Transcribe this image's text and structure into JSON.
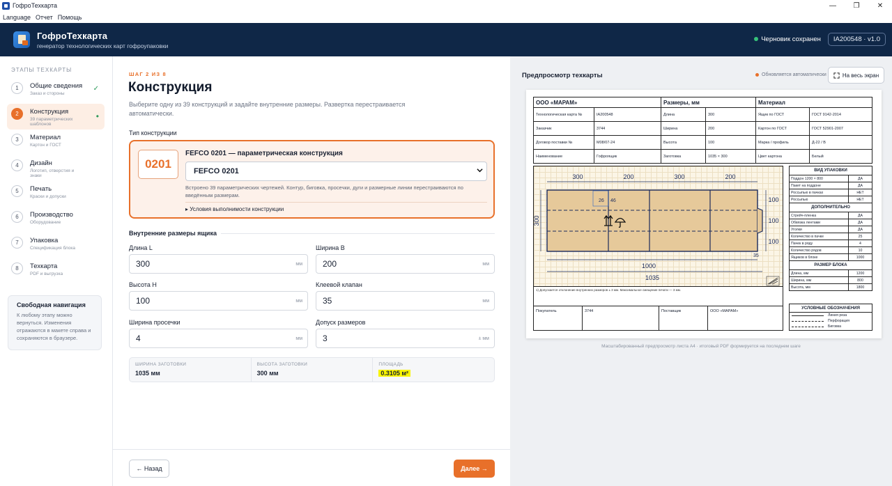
{
  "window": {
    "title": "ГофроТехкарта",
    "controls": [
      "—",
      "❐",
      "✕"
    ]
  },
  "menu": [
    "Language",
    "Отчет",
    "Помощь"
  ],
  "header": {
    "title": "ГофроТехкарта",
    "subtitle": "генератор технологических карт гофроупаковки",
    "status": "Черновик сохранен",
    "version": "IA200548 · v1.0",
    "status_color": "#36c27a"
  },
  "sidebar": {
    "title": "ЭТАПЫ ТЕХКАРТЫ",
    "steps": [
      {
        "num": "1",
        "label": "Общие сведения",
        "sub": "Заказ и стороны",
        "mark": "✓"
      },
      {
        "num": "2",
        "label": "Конструкция",
        "sub": "39 параметрических шаблонов",
        "mark": "•"
      },
      {
        "num": "3",
        "label": "Материал",
        "sub": "Картон и ГОСТ",
        "mark": ""
      },
      {
        "num": "4",
        "label": "Дизайн",
        "sub": "Логотип, отверстия и знаки",
        "mark": ""
      },
      {
        "num": "5",
        "label": "Печать",
        "sub": "Краски и допуски",
        "mark": ""
      },
      {
        "num": "6",
        "label": "Производство",
        "sub": "Оборудование",
        "mark": ""
      },
      {
        "num": "7",
        "label": "Упаковка",
        "sub": "Спецификация блока",
        "mark": ""
      },
      {
        "num": "8",
        "label": "Техкарта",
        "sub": "PDF и выгрузка",
        "mark": ""
      }
    ],
    "navbox": {
      "title": "Свободная навигация",
      "text": "К любому этапу можно вернуться. Изменения отражаются в макете справа и сохраняются в браузере."
    }
  },
  "main": {
    "step_no": "ШАГ 2 ИЗ 8",
    "title": "Конструкция",
    "description": "Выберите одну из 39 конструкций и задайте внутренние размеры. Развертка перестраивается автоматически.",
    "type_label": "Тип конструкции",
    "construction": {
      "code": "0201",
      "name": "FEFCO 0201 — параметрическая конструкция",
      "selected": "FEFCO 0201",
      "note": "Встроено 39 параметрических чертежей. Контур, биговка, просечки, дуги и размерные линии перестраиваются по введённым размерам.",
      "expander": "▸ Условия выполнимости конструкции"
    },
    "dims_title": "Внутренние размеры ящика",
    "fields": [
      {
        "label": "Длина L",
        "value": "300",
        "unit": "мм"
      },
      {
        "label": "Ширина B",
        "value": "200",
        "unit": "мм"
      },
      {
        "label": "Высота H",
        "value": "100",
        "unit": "мм"
      },
      {
        "label": "Клеевой клапан",
        "value": "35",
        "unit": "мм"
      },
      {
        "label": "Ширина просечки",
        "value": "4",
        "unit": "мм"
      },
      {
        "label": "Допуск размеров",
        "value": "3",
        "unit": "± мм"
      }
    ],
    "summary": [
      {
        "key": "ШИРИНА ЗАГОТОВКИ",
        "value": "1035 мм"
      },
      {
        "key": "ВЫСОТА ЗАГОТОВКИ",
        "value": "300 мм"
      },
      {
        "key": "ПЛОЩАДЬ",
        "value": "0.3105 м²"
      }
    ],
    "back": "← Назад",
    "next": "Далее →",
    "accent": "#e8702a"
  },
  "preview": {
    "title": "Предпросмотр техкарты",
    "auto": "Обновляется автоматически",
    "fullscreen": "На весь экран",
    "caption": "Масштабированный предпросмотр листа А4 · итоговый PDF формируется на последнем шаге",
    "sheet": {
      "headers": [
        "ООО «МАРАМ»",
        "Размеры, мм",
        "Материал"
      ],
      "rows": [
        [
          "Технологическая карта №",
          "IA200548",
          "Длина",
          "300",
          "Ящик по ГОСТ",
          "ГОСТ 9142-2014"
        ],
        [
          "Заказчик",
          "3744",
          "Ширина",
          "200",
          "Картон по ГОСТ",
          "ГОСТ 52901-2007"
        ],
        [
          "Договор поставки №",
          "М08/07-24",
          "Высота",
          "100",
          "Марка / профиль",
          "Д-22 / В"
        ],
        [
          "Наименование",
          "Гофроящик",
          "Заготовка",
          "1035 × 300",
          "Цвет картона",
          "Белый"
        ]
      ],
      "drawing": {
        "panels": [
          "300",
          "200",
          "300",
          "200"
        ],
        "heights": [
          "100",
          "100",
          "100"
        ],
        "total_height": "300",
        "inner_width": "1000",
        "total_width": "1035",
        "flap": "35",
        "logo_w": "26",
        "logo_h": "46"
      },
      "note": "1) Допускается отклонение внутренних размеров ± 3 мм. Максимальное смещение печати — 3 мм.",
      "bottom": [
        "Покупатель",
        "3744",
        "Поставщик",
        "ООО «МАРАМ»"
      ],
      "right": {
        "sections": [
          {
            "title": "ВИД УПАКОВКИ",
            "rows": [
              [
                "Поддон 1200 × 800",
                "ДА"
              ],
              [
                "Пакет на поддоне",
                "ДА"
              ],
              [
                "Россыпью в пачках",
                "НЕТ"
              ],
              [
                "Россыпью",
                "НЕТ"
              ]
            ]
          },
          {
            "title": "ДОПОЛНИТЕЛЬНО",
            "rows": [
              [
                "Стрейч-пленка",
                "ДА"
              ],
              [
                "Обвязка лентами",
                "ДА"
              ],
              [
                "Уголки",
                "ДА"
              ],
              [
                "Количество в пачке",
                "25"
              ],
              [
                "Пачек в ряду",
                "4"
              ],
              [
                "Количество рядов",
                "10"
              ],
              [
                "Ящиков в блоке",
                "1000"
              ]
            ]
          },
          {
            "title": "РАЗМЕР БЛОКА",
            "rows": [
              [
                "Длина, мм",
                "1200"
              ],
              [
                "Ширина, мм",
                "800"
              ],
              [
                "Высота, мм",
                "1800"
              ]
            ]
          }
        ]
      },
      "legend": {
        "title": "УСЛОВНЫЕ ОБОЗНАЧЕНИЯ",
        "items": [
          "Линия реза",
          "Перфорация",
          "Биговка"
        ]
      }
    }
  }
}
